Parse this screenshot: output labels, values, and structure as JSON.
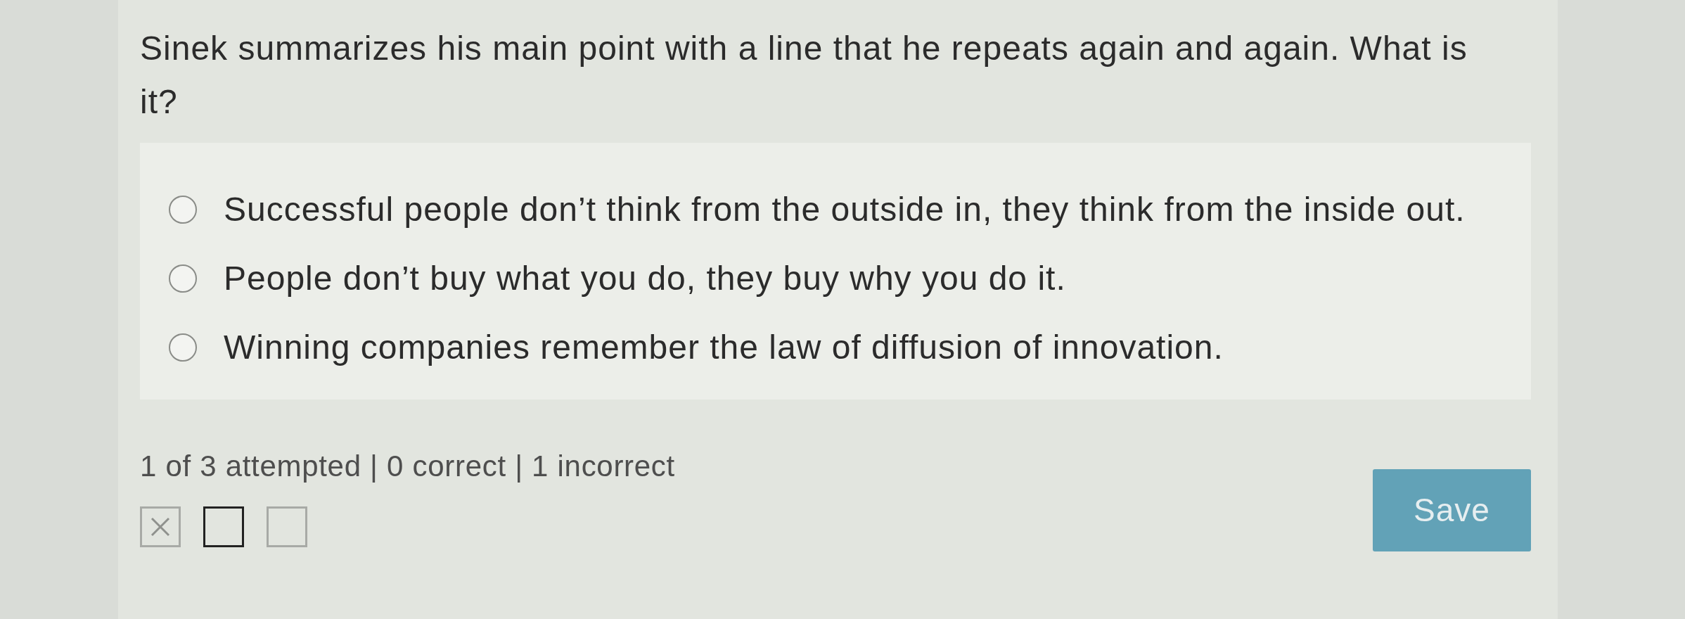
{
  "question": {
    "text": "Sinek summarizes his main point with a line that he repeats again and again. What is it?"
  },
  "options": [
    {
      "label": "Successful people don’t think from the outside in, they think from the inside out.",
      "selected": false
    },
    {
      "label": "People don’t buy what you do, they buy why you do it.",
      "selected": false
    },
    {
      "label": "Winning companies remember the law of diffusion of innovation.",
      "selected": false
    }
  ],
  "progress": {
    "summary": "1 of 3 attempted | 0 correct | 1 incorrect",
    "items": [
      {
        "kind": "incorrect",
        "selected": false
      },
      {
        "kind": "unanswered",
        "selected": true
      },
      {
        "kind": "unanswered",
        "selected": false
      }
    ]
  },
  "save_button": {
    "label": "Save",
    "disabled": true
  }
}
